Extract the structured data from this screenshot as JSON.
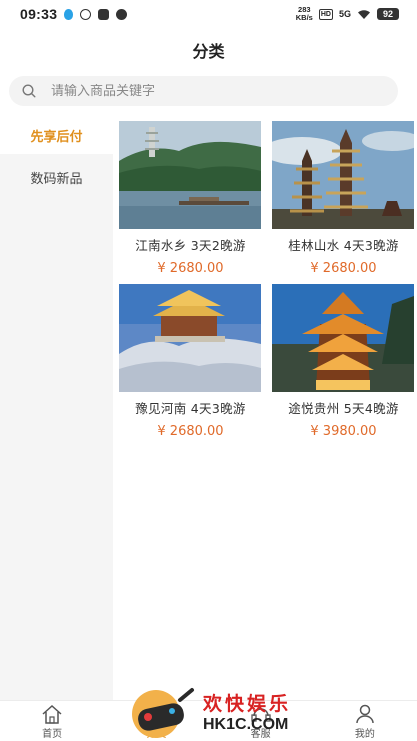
{
  "status": {
    "time": "09:33",
    "net_speed_value": "283",
    "net_speed_unit": "KB/s",
    "hd": "HD",
    "signal": "5G",
    "battery": "92"
  },
  "header": {
    "title": "分类"
  },
  "search": {
    "placeholder": "请输入商品关键字"
  },
  "sidebar": {
    "items": [
      {
        "label": "先享后付",
        "active": true
      },
      {
        "label": "数码新品",
        "active": false
      }
    ]
  },
  "products": [
    {
      "title": "江南水乡 3天2晚游",
      "price": "¥ 2680.00",
      "image": "lake-pagoda-photo"
    },
    {
      "title": "桂林山水 4天3晚游",
      "price": "¥ 2680.00",
      "image": "twin-pagodas-photo"
    },
    {
      "title": "豫见河南 4天3晚游",
      "price": "¥ 2680.00",
      "image": "snow-temple-photo"
    },
    {
      "title": "途悦贵州 5天4晚游",
      "price": "¥ 3980.00",
      "image": "drum-tower-photo"
    }
  ],
  "tabbar": {
    "items": [
      {
        "label": "首页",
        "icon": "home-icon"
      },
      {
        "label": "分类",
        "icon": "category-icon",
        "active": true
      },
      {
        "label": "客服",
        "icon": "service-icon"
      },
      {
        "label": "我的",
        "icon": "user-icon"
      }
    ]
  },
  "watermark": {
    "brand_cn": "欢快娱乐",
    "brand_site": "HK1C.COM"
  },
  "colors": {
    "accent": "#e0901e",
    "price": "#e06a2a",
    "sidebar_bg": "#f5f5f5"
  }
}
